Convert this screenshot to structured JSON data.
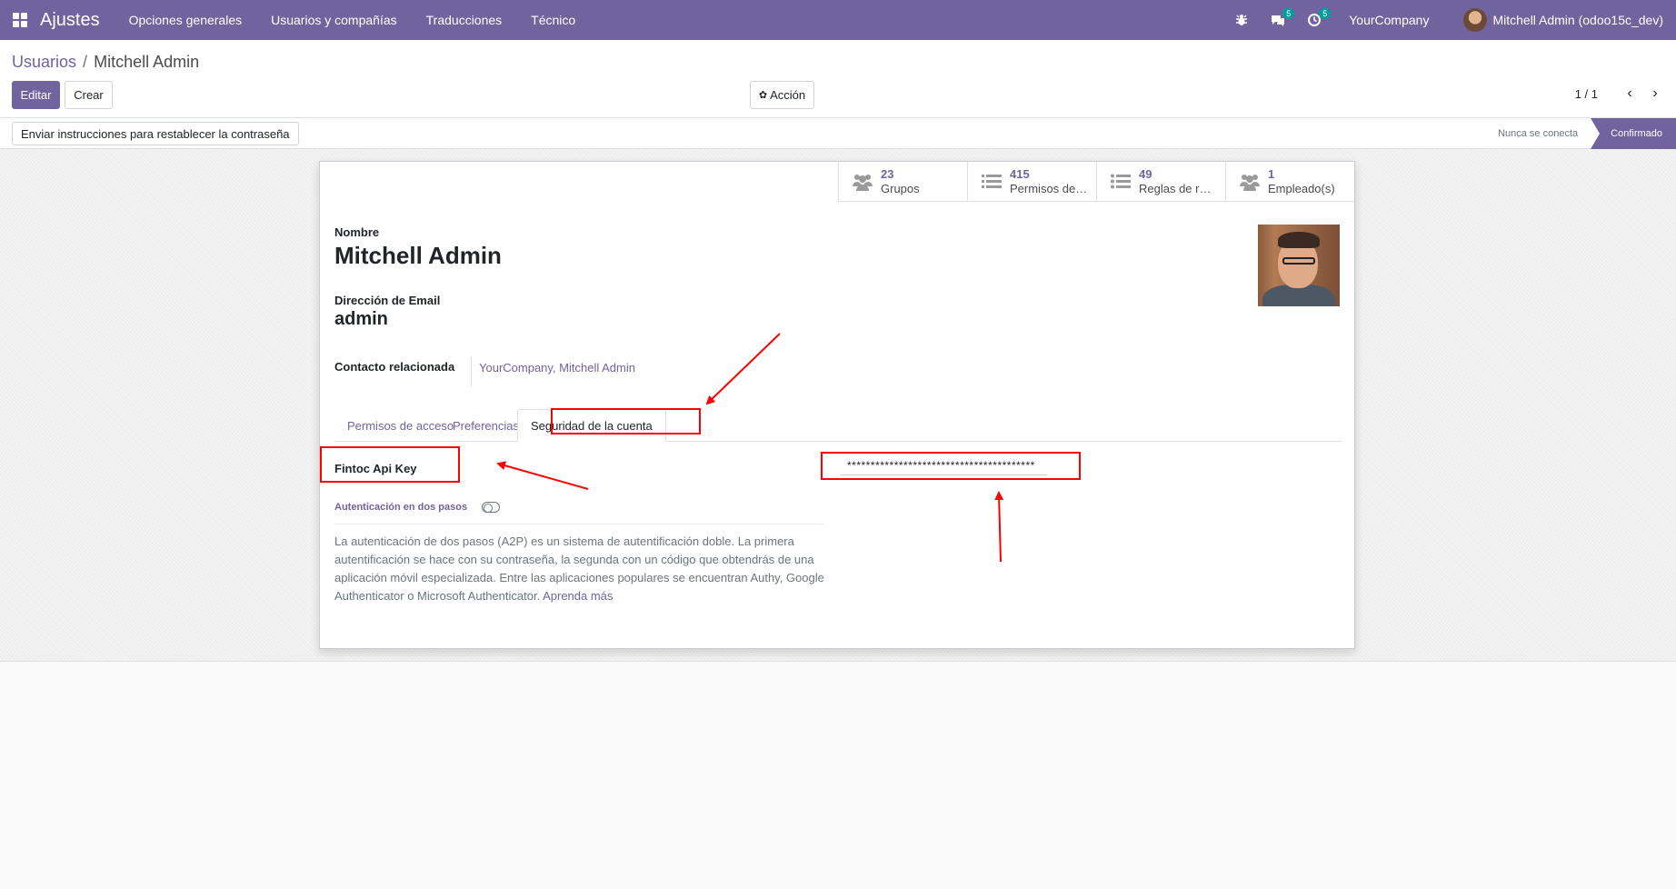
{
  "navbar": {
    "app_name": "Ajustes",
    "menu": [
      "Opciones generales",
      "Usuarios y compañías",
      "Traducciones",
      "Técnico"
    ],
    "messages_count": "5",
    "activities_count": "5",
    "company": "YourCompany",
    "user": "Mitchell Admin (odoo15c_dev)"
  },
  "breadcrumb": {
    "parent": "Usuarios",
    "separator": "/",
    "current": "Mitchell Admin"
  },
  "actions": {
    "edit": "Editar",
    "create": "Crear",
    "action": "Acción"
  },
  "pager": {
    "value": "1 / 1"
  },
  "statusbar": {
    "reset_password": "Enviar instrucciones para restablecer la contraseña",
    "state_inactive": "Nunca se conecta",
    "state_active": "Confirmado"
  },
  "stat_buttons": [
    {
      "value": "23",
      "label": "Grupos",
      "icon": "users-icon"
    },
    {
      "value": "415",
      "label": "Permisos de…",
      "icon": "list-icon"
    },
    {
      "value": "49",
      "label": "Reglas de re…",
      "icon": "list-icon"
    },
    {
      "value": "1",
      "label": "Empleado(s)",
      "icon": "users-icon"
    }
  ],
  "form": {
    "name_label": "Nombre",
    "name_value": "Mitchell Admin",
    "email_label": "Dirección de Email",
    "email_value": "admin",
    "contact_label": "Contacto relacionada",
    "contact_value": "YourCompany, Mitchell Admin"
  },
  "tabs": [
    "Permisos de acceso",
    "Preferencias",
    "Seguridad de la cuenta"
  ],
  "security": {
    "api_key_label": "Fintoc Api Key",
    "api_key_value": "****************************************",
    "twofa_label": "Autenticación en dos pasos",
    "help_text": "La autenticación de dos pasos (A2P) es un sistema de autentificación doble. La primera autentificación se hace con su contraseña, la segunda con un código que obtendrás de una aplicación móvil especializada. Entre las aplicaciones populares se encuentran Authy, Google Authenticator o Microsoft Authenticator.",
    "learn_more": "Aprenda más"
  },
  "colors": {
    "brand": "#71639e",
    "annotation": "#ff0000",
    "badge": "#00a09d"
  }
}
